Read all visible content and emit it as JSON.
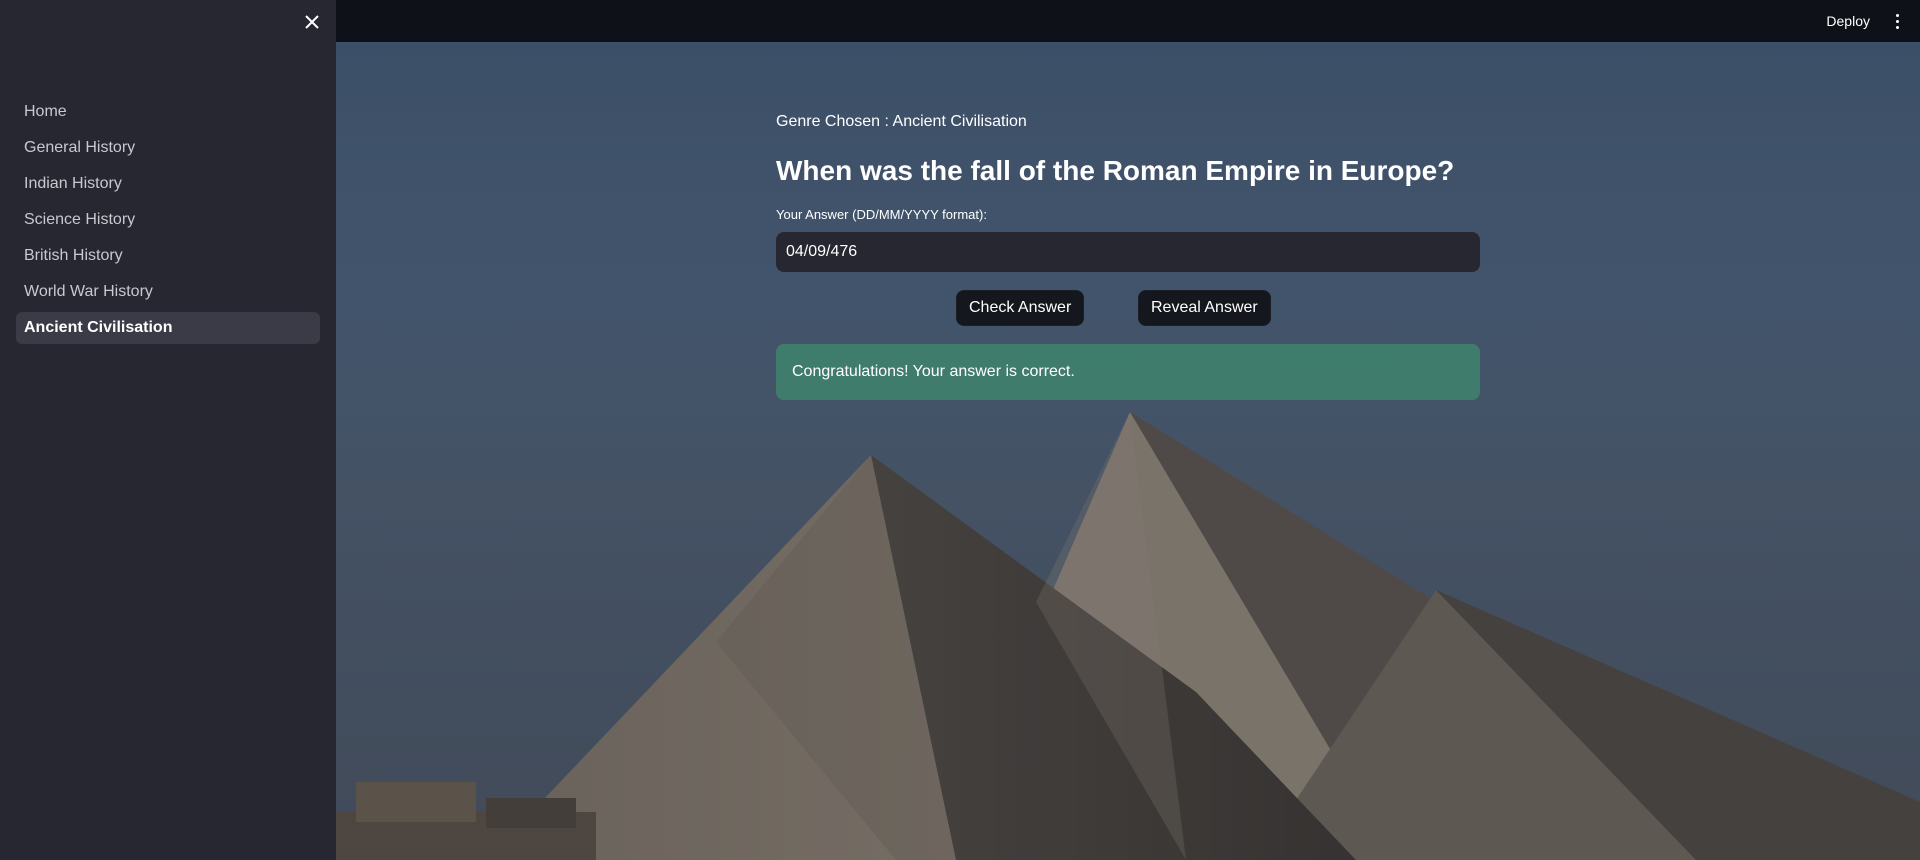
{
  "sidebar": {
    "close_icon": "close-icon",
    "items": [
      {
        "label": "Home",
        "active": false
      },
      {
        "label": "General History",
        "active": false
      },
      {
        "label": "Indian History",
        "active": false
      },
      {
        "label": "Science History",
        "active": false
      },
      {
        "label": "British History",
        "active": false
      },
      {
        "label": "World War History",
        "active": false
      },
      {
        "label": "Ancient Civilisation",
        "active": true
      }
    ]
  },
  "header": {
    "deploy_label": "Deploy",
    "menu_icon": "kebab-menu-icon"
  },
  "main": {
    "genre_text": "Genre Chosen : Ancient Civilisation",
    "question": "When was the fall of the Roman Empire in Europe?",
    "answer_label": "Your Answer (DD/MM/YYYY format):",
    "answer_value": "04/09/476",
    "check_button": "Check Answer",
    "reveal_button": "Reveal Answer",
    "success_message": "Congratulations! Your answer is correct."
  },
  "colors": {
    "sidebar_bg": "#262730",
    "header_bg": "#0e1117",
    "success_bg": "#3d896e",
    "input_bg": "#262730"
  }
}
